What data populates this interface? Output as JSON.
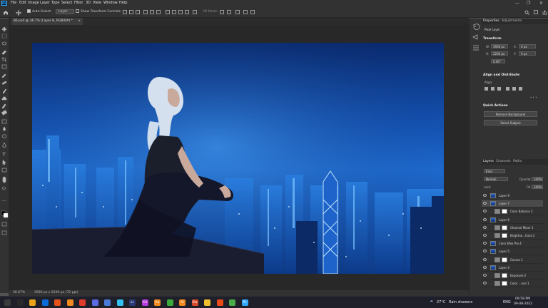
{
  "app": {
    "logo_text": "Ps"
  },
  "menu": [
    "File",
    "Edit",
    "Image",
    "Layer",
    "Type",
    "Select",
    "Filter",
    "3D",
    "View",
    "Window",
    "Help"
  ],
  "window_controls": [
    "—",
    "❐",
    "✕"
  ],
  "options_bar": {
    "auto_select_label": "Auto-Select:",
    "auto_select_value": "Layer",
    "show_transform_label": "Show Transform Controls",
    "mode_3d_label": "3D Mode:"
  },
  "document_tab": {
    "title": "86.psd @ 36.7% (Layer 8, RGB/8#) *",
    "close": "×"
  },
  "status_bar": {
    "zoom": "36.67%",
    "doc_size": "3936 px x 2200 px (72 ppi)",
    "arrow": "›"
  },
  "properties_panel": {
    "tabs": [
      "Properties",
      "Adjustments"
    ],
    "layer_type": "Pixel Layer",
    "transform_title": "Transform",
    "w_label": "W:",
    "w_value": "3936 px",
    "h_label": "H:",
    "h_value": "2200 px",
    "x_label": "X:",
    "x_value": "0 px",
    "y_label": "Y:",
    "y_value": "0 px",
    "angle_value": "0.00°",
    "align_title": "Align and Distribute",
    "align_label": "Align:",
    "more": "• • •",
    "quick_actions_title": "Quick Actions",
    "remove_bg": "Remove Background",
    "select_subject": "Select Subject"
  },
  "layers_panel": {
    "tabs": [
      "Layers",
      "Channels",
      "Paths"
    ],
    "kind_label": "Kind",
    "blend_mode": "Normal",
    "opacity_label": "Opacity:",
    "opacity_value": "100%",
    "lock_label": "Lock:",
    "fill_label": "Fill:",
    "fill_value": "100%",
    "layers": [
      {
        "name": "Layer 9",
        "selected": false,
        "kind": "pixel"
      },
      {
        "name": "Layer 7",
        "selected": true,
        "kind": "pixel"
      },
      {
        "name": "Color Balance 2",
        "selected": false,
        "kind": "adjust"
      },
      {
        "name": "Layer 6",
        "selected": false,
        "kind": "pixel"
      },
      {
        "name": "Channel Mixer 1",
        "selected": false,
        "kind": "adjust"
      },
      {
        "name": "Brightne...trast 2",
        "selected": false,
        "kind": "adjust"
      },
      {
        "name": "Color Efex Pro 4",
        "selected": false,
        "kind": "pixel"
      },
      {
        "name": "Layer 5",
        "selected": false,
        "kind": "pixel"
      },
      {
        "name": "Curves 1",
        "selected": false,
        "kind": "adjust"
      },
      {
        "name": "Layer 4",
        "selected": false,
        "kind": "pixel"
      },
      {
        "name": "Exposure 2",
        "selected": false,
        "kind": "adjust"
      },
      {
        "name": "Color ...nce 1",
        "selected": false,
        "kind": "adjust"
      }
    ]
  },
  "taskbar": {
    "weather_temp": "27°C",
    "weather_desc": "Rain showers",
    "lang": "ENG",
    "time": "09:58 PM",
    "date": "09-08-2022",
    "app_colors": [
      "#3b3b3b",
      "#2a2a2a",
      "#e8a318",
      "#0a6ad8",
      "#e5531a",
      "#f08a1e",
      "#e03a2a",
      "#5a6ae0",
      "#4a7ad8",
      "#31c0f0",
      "#2a3a78",
      "#b03ad8",
      "#f08a1e",
      "#3aaa3a",
      "#f08a1e",
      "#d84a2a",
      "#f0c030",
      "#e84a1a",
      "#4aaa4a",
      "#31a8ff"
    ],
    "app_letters": [
      "",
      "",
      "",
      "",
      "",
      "",
      "",
      "",
      "",
      "",
      "Lr",
      "Xd",
      "Ae",
      "",
      "Ai",
      "Dw",
      "",
      "",
      "",
      "Ps"
    ]
  },
  "colors": {
    "accent": "#31a8ff",
    "panel": "#323232",
    "workspace": "#282828"
  }
}
